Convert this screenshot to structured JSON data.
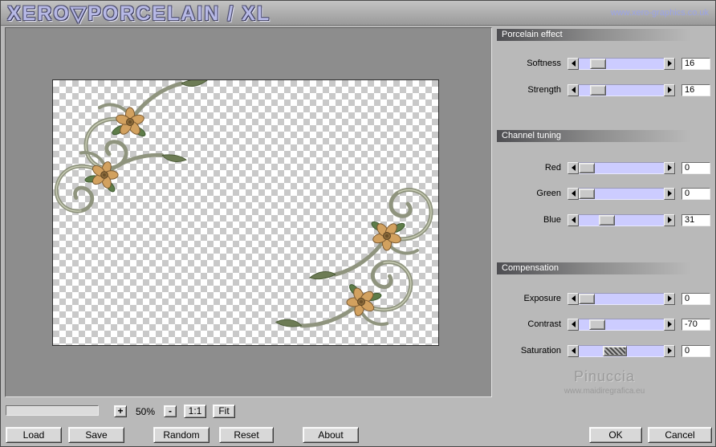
{
  "header": {
    "title": "XERO▽PORCELAIN / XL",
    "url": "www.xero-graphics.co.uk"
  },
  "groups": [
    {
      "title": "Porcelain effect",
      "sliders": [
        {
          "label": "Softness",
          "value": "16",
          "percent": 16
        },
        {
          "label": "Strength",
          "value": "16",
          "percent": 16
        }
      ]
    },
    {
      "title": "Channel tuning",
      "sliders": [
        {
          "label": "Red",
          "value": "0",
          "percent": 0
        },
        {
          "label": "Green",
          "value": "0",
          "percent": 0
        },
        {
          "label": "Blue",
          "value": "31",
          "percent": 29
        }
      ]
    },
    {
      "title": "Compensation",
      "sliders": [
        {
          "label": "Exposure",
          "value": "0",
          "percent": 0
        },
        {
          "label": "Contrast",
          "value": "-70",
          "percent": 15
        },
        {
          "label": "Saturation",
          "value": "0",
          "percent": 40
        }
      ]
    }
  ],
  "watermark": {
    "name": "Pinuccia",
    "url": "www.maidiregrafica.eu"
  },
  "zoom": {
    "plus": "+",
    "level": "50%",
    "minus": "-",
    "one_to_one": "1:1",
    "fit": "Fit"
  },
  "buttons": {
    "load": "Load",
    "save": "Save",
    "random": "Random",
    "reset": "Reset",
    "about": "About",
    "ok": "OK",
    "cancel": "Cancel"
  },
  "colors": {
    "slider_track": "#ccccff",
    "logo_text": "#b7b9e6"
  }
}
